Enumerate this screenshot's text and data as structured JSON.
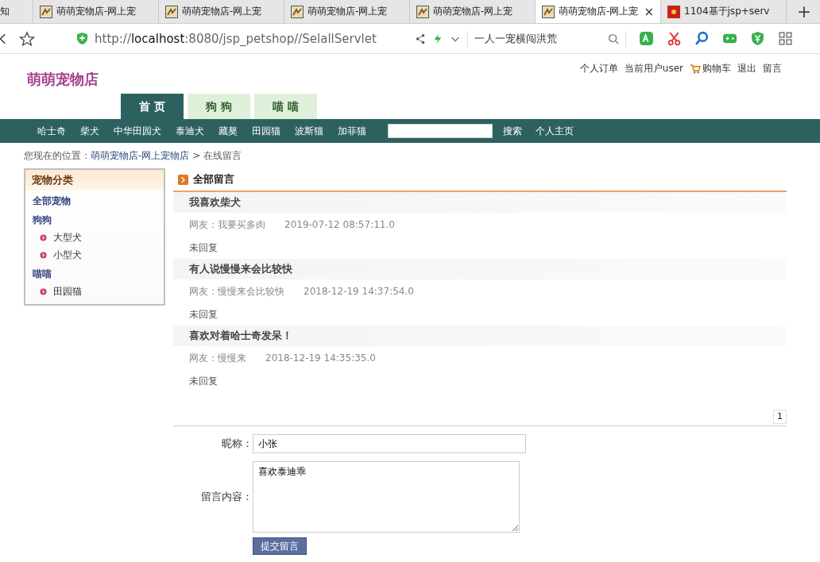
{
  "browser": {
    "tabs": [
      {
        "title": "知",
        "selected": false,
        "kind": "plain"
      },
      {
        "title": "萌萌宠物店-网上宠",
        "selected": false,
        "kind": "site"
      },
      {
        "title": "萌萌宠物店-网上宠",
        "selected": false,
        "kind": "site"
      },
      {
        "title": "萌萌宠物店-网上宠",
        "selected": false,
        "kind": "site"
      },
      {
        "title": "萌萌宠物店-网上宠",
        "selected": false,
        "kind": "site"
      },
      {
        "title": "萌萌宠物店-网上宠",
        "selected": true,
        "kind": "site"
      },
      {
        "title": "1104基于jsp+serv",
        "selected": false,
        "kind": "red"
      }
    ],
    "new_tab": "+",
    "close": "×",
    "url": {
      "scheme": "http://",
      "host": "localhost",
      "rest": ":8080/jsp_petshop//SelallServlet"
    },
    "search_text": "一人一宠横闯洪荒"
  },
  "site": {
    "logo": "萌萌宠物店",
    "top_links": [
      {
        "label": "个人订单",
        "kind": "link"
      },
      {
        "label": "当前用户user",
        "kind": "text"
      },
      {
        "label": "购物车",
        "kind": "cart"
      },
      {
        "label": "退出",
        "kind": "link"
      },
      {
        "label": "留言",
        "kind": "link"
      }
    ],
    "nav_tabs": [
      {
        "label": "首 页",
        "selected": true
      },
      {
        "label": "狗 狗",
        "selected": false
      },
      {
        "label": "喵 喵",
        "selected": false
      }
    ],
    "category_bar": {
      "items": [
        "哈士奇",
        "柴犬",
        "中华田园犬",
        "泰迪犬",
        "藏獒",
        "田园猫",
        "波斯猫",
        "加菲猫"
      ],
      "search_button": "搜索",
      "home_link": "个人主页"
    },
    "breadcrumb": {
      "prefix": "您现在的位置：",
      "link": "萌萌宠物店-网上宠物店",
      "suffix": " > 在线留言"
    }
  },
  "sidebar": {
    "title": "宠物分类",
    "items": [
      {
        "label": "全部宠物"
      },
      {
        "label": "狗狗",
        "children": [
          {
            "label": "大型犬"
          },
          {
            "label": "小型犬"
          }
        ]
      },
      {
        "label": "喵喵",
        "children": [
          {
            "label": "田园猫"
          }
        ]
      }
    ]
  },
  "messages": {
    "title": "全部留言",
    "items": [
      {
        "title": "我喜欢柴犬",
        "author": "网友：我要买多肉",
        "time": "2019-07-12 08:57:11.0",
        "reply": "未回复"
      },
      {
        "title": "有人说慢慢来会比较快",
        "author": "网友：慢慢来会比较快",
        "time": "2018-12-19 14:37:54.0",
        "reply": "未回复"
      },
      {
        "title": "喜欢对着哈士奇发呆！",
        "author": "网友：慢慢来",
        "time": "2018-12-19 14:35:35.0",
        "reply": "未回复"
      }
    ],
    "pages": [
      {
        "label": "1",
        "selected": true
      }
    ]
  },
  "form": {
    "nickname_label": "昵称：",
    "nickname": "小张",
    "content_label": "留言内容：",
    "content": "喜欢泰迪乖",
    "submit": "提交留言"
  }
}
